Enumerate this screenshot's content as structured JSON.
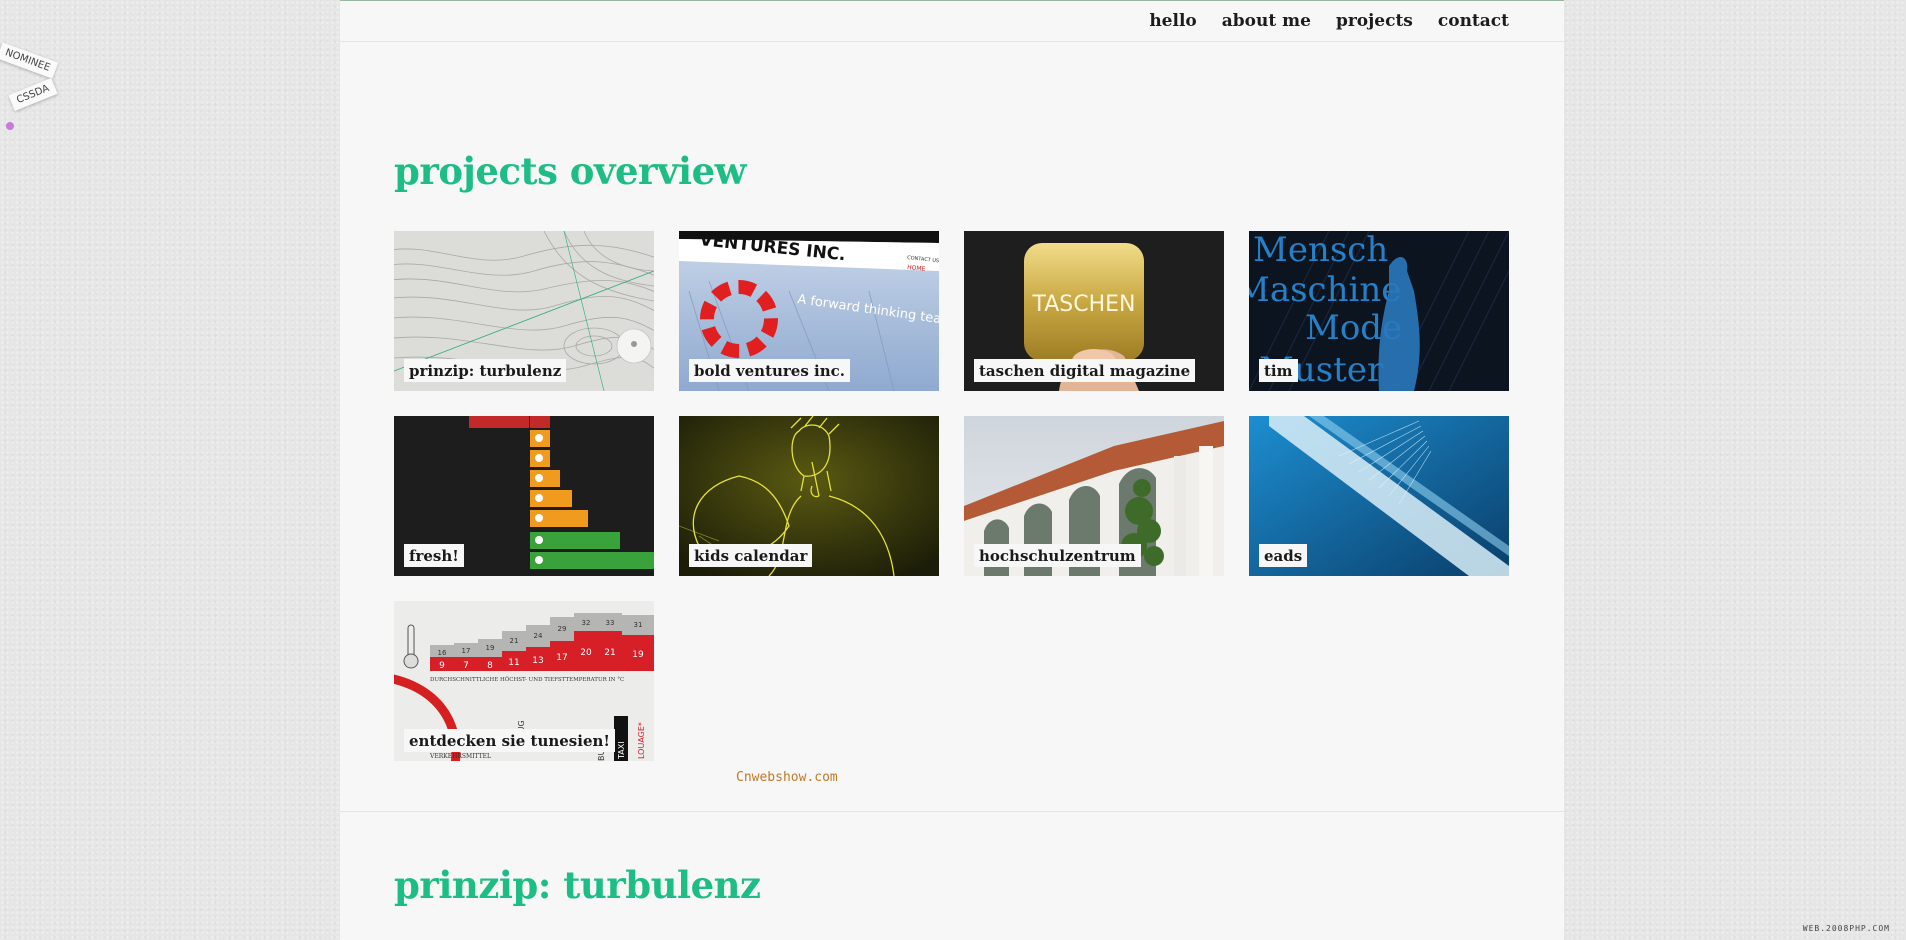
{
  "nav": {
    "items": [
      {
        "label": "hello"
      },
      {
        "label": "about me"
      },
      {
        "label": "projects"
      },
      {
        "label": "contact"
      }
    ]
  },
  "overview": {
    "title": "projects overview"
  },
  "projects": [
    {
      "label": "prinzip: turbulenz"
    },
    {
      "label": "bold ventures inc."
    },
    {
      "label": "taschen digital magazine"
    },
    {
      "label": "tim"
    },
    {
      "label": "fresh!"
    },
    {
      "label": "kids calendar"
    },
    {
      "label": "hochschulzentrum"
    },
    {
      "label": "eads"
    },
    {
      "label": "entdecken sie tunesien!"
    }
  ],
  "thumb_text": {
    "bold_ventures": "VENTURES INC.",
    "bold_ventures_sub": "A forward thinking team of geologists breaking new ground resource exploration",
    "bold_ventures_nav": "CONTACT US",
    "bold_ventures_nav2": "HOME",
    "taschen": "TASCHEN",
    "tim_lines": [
      "Mensch",
      "Maschine",
      "Mode",
      "Muster"
    ],
    "tunesien_caption": "DURCHSCHNITTLICHE HÖCHST- UND TIEFSTTEMPERATUR IN °C",
    "tunesien_numbers": [
      "9",
      "7",
      "8",
      "11",
      "13",
      "17",
      "20",
      "21",
      "19"
    ],
    "tunesien_top": [
      "16",
      "17",
      "19",
      "21",
      "24",
      "29",
      "32",
      "33",
      "31"
    ],
    "tunesien_footer": "VERKEHRSMITTEL",
    "tunesien_vertical": [
      "FLUG",
      "BUS",
      "TAXI",
      "LOUAGE*"
    ]
  },
  "section2": {
    "title": "prinzip: turbulenz"
  },
  "badge": {
    "line1": "NOMINEE",
    "line2": "CSSDA"
  },
  "watermark": "Cnwebshow.com",
  "corner_mark": "WEB.2008PHP.COM",
  "colors": {
    "accent": "#1fbd86",
    "nav_text": "#1c1c1c",
    "page_bg": "#f7f7f7"
  }
}
